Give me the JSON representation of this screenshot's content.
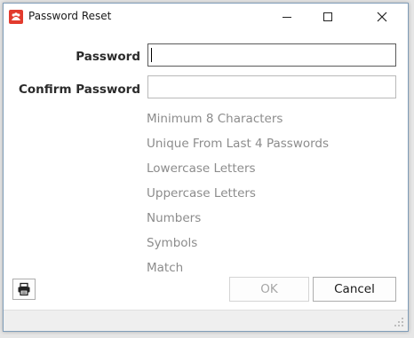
{
  "window": {
    "title": "Password Reset",
    "app_icon": "app-logo-icon",
    "controls": {
      "minimize_icon": "minimize-icon",
      "maximize_icon": "maximize-icon",
      "close_icon": "close-icon"
    }
  },
  "form": {
    "password_label": "Password",
    "password_value": "",
    "confirm_label": "Confirm Password",
    "confirm_value": ""
  },
  "requirements": [
    "Minimum 8 Characters",
    "Unique From Last 4 Passwords",
    "Lowercase Letters",
    "Uppercase Letters",
    "Numbers",
    "Symbols",
    "Match"
  ],
  "buttons": {
    "print_icon": "printer-icon",
    "ok_label": "OK",
    "ok_enabled": false,
    "cancel_label": "Cancel"
  },
  "colors": {
    "app_icon_bg": "#e23b2e",
    "requirement_text": "#8c8c8c",
    "disabled_text": "#a6a6a6"
  }
}
